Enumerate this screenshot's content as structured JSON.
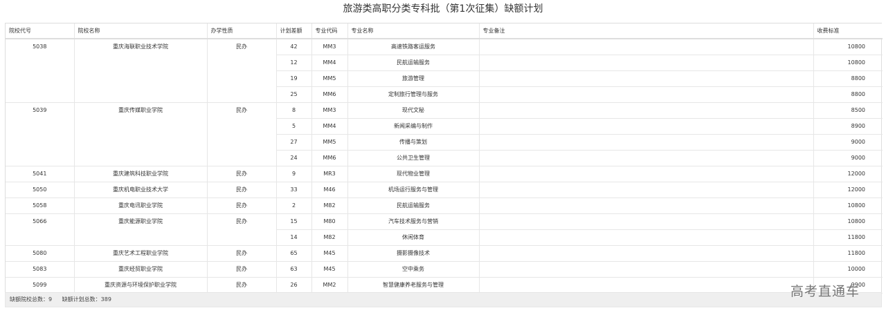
{
  "title": "旅游类高职分类专科批（第1次征集）缺额计划",
  "columns": [
    "院校代号",
    "院校名称",
    "办学性质",
    "计划差额",
    "专业代码",
    "专业名称",
    "专业备注",
    "收费标准"
  ],
  "schools": [
    {
      "code": "5038",
      "name": "重庆海联职业技术学院",
      "type": "民办",
      "majors": [
        {
          "gap": "42",
          "mcode": "MM3",
          "mname": "高速铁路客运服务",
          "note": "",
          "fee": "10800"
        },
        {
          "gap": "12",
          "mcode": "MM4",
          "mname": "民航运输服务",
          "note": "",
          "fee": "10800"
        },
        {
          "gap": "19",
          "mcode": "MM5",
          "mname": "旅游管理",
          "note": "",
          "fee": "8800"
        },
        {
          "gap": "25",
          "mcode": "MM6",
          "mname": "定制旅行管理与服务",
          "note": "",
          "fee": "8800"
        }
      ]
    },
    {
      "code": "5039",
      "name": "重庆传媒职业学院",
      "type": "民办",
      "majors": [
        {
          "gap": "8",
          "mcode": "MM3",
          "mname": "现代文秘",
          "note": "",
          "fee": "8500"
        },
        {
          "gap": "5",
          "mcode": "MM4",
          "mname": "新闻采编与制作",
          "note": "",
          "fee": "8900"
        },
        {
          "gap": "27",
          "mcode": "MM5",
          "mname": "传播与策划",
          "note": "",
          "fee": "9000"
        },
        {
          "gap": "24",
          "mcode": "MM6",
          "mname": "公共卫生管理",
          "note": "",
          "fee": "9000"
        }
      ]
    },
    {
      "code": "5041",
      "name": "重庆建筑科技职业学院",
      "type": "民办",
      "majors": [
        {
          "gap": "9",
          "mcode": "MR3",
          "mname": "现代物业管理",
          "note": "",
          "fee": "12000"
        }
      ]
    },
    {
      "code": "5050",
      "name": "重庆机电职业技术大学",
      "type": "民办",
      "majors": [
        {
          "gap": "33",
          "mcode": "M46",
          "mname": "机场运行服务与管理",
          "note": "",
          "fee": "12000"
        }
      ]
    },
    {
      "code": "5058",
      "name": "重庆电讯职业学院",
      "type": "民办",
      "majors": [
        {
          "gap": "2",
          "mcode": "M82",
          "mname": "民航运输服务",
          "note": "",
          "fee": "10800"
        }
      ]
    },
    {
      "code": "5066",
      "name": "重庆能源职业学院",
      "type": "民办",
      "majors": [
        {
          "gap": "15",
          "mcode": "M80",
          "mname": "汽车技术服务与营销",
          "note": "",
          "fee": "10800"
        },
        {
          "gap": "14",
          "mcode": "M82",
          "mname": "休闲体育",
          "note": "",
          "fee": "11800"
        }
      ]
    },
    {
      "code": "5080",
      "name": "重庆艺术工程职业学院",
      "type": "民办",
      "majors": [
        {
          "gap": "65",
          "mcode": "M45",
          "mname": "摄影摄像技术",
          "note": "",
          "fee": "11800"
        }
      ]
    },
    {
      "code": "5083",
      "name": "重庆经贸职业学院",
      "type": "民办",
      "majors": [
        {
          "gap": "63",
          "mcode": "M45",
          "mname": "空中乘务",
          "note": "",
          "fee": "10000"
        }
      ]
    },
    {
      "code": "5099",
      "name": "重庆资源与环境保护职业学院",
      "type": "民办",
      "majors": [
        {
          "gap": "26",
          "mcode": "MM2",
          "mname": "智慧健康养老服务与管理",
          "note": "",
          "fee": "9900"
        }
      ]
    }
  ],
  "footer": {
    "school_total": "缺额院校总数：9",
    "plan_total": "缺额计划总数：389"
  },
  "watermark": "高考直通车"
}
